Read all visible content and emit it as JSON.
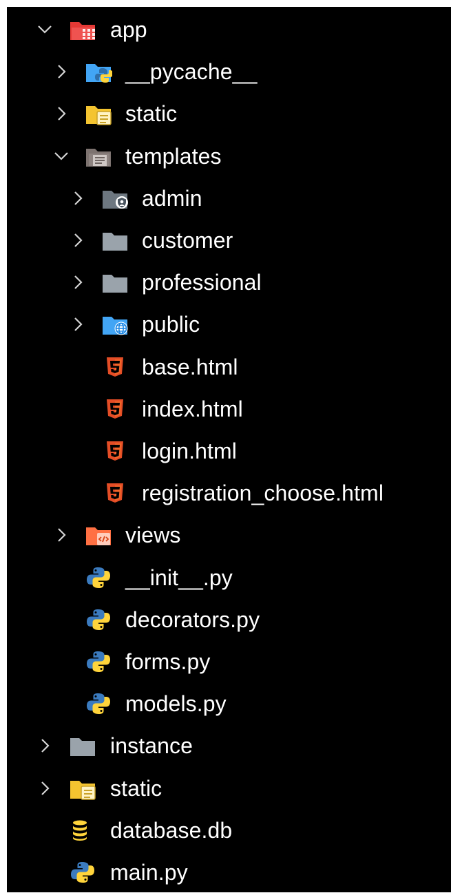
{
  "tree": [
    {
      "label": "app",
      "kind": "folder-open",
      "icon": "folder-app-icon",
      "depth": 0
    },
    {
      "label": "__pycache__",
      "kind": "folder",
      "icon": "folder-python-icon",
      "depth": 1
    },
    {
      "label": "static",
      "kind": "folder",
      "icon": "folder-static-icon",
      "depth": 1
    },
    {
      "label": "templates",
      "kind": "folder-open",
      "icon": "folder-templates-icon",
      "depth": 1
    },
    {
      "label": "admin",
      "kind": "folder",
      "icon": "folder-admin-icon",
      "depth": 2
    },
    {
      "label": "customer",
      "kind": "folder",
      "icon": "folder-icon",
      "depth": 2
    },
    {
      "label": "professional",
      "kind": "folder",
      "icon": "folder-icon",
      "depth": 2
    },
    {
      "label": "public",
      "kind": "folder",
      "icon": "folder-public-icon",
      "depth": 2
    },
    {
      "label": "base.html",
      "kind": "file",
      "icon": "html5-icon",
      "depth": 2
    },
    {
      "label": "index.html",
      "kind": "file",
      "icon": "html5-icon",
      "depth": 2
    },
    {
      "label": "login.html",
      "kind": "file",
      "icon": "html5-icon",
      "depth": 2
    },
    {
      "label": "registration_choose.html",
      "kind": "file",
      "icon": "html5-icon",
      "depth": 2
    },
    {
      "label": "views",
      "kind": "folder",
      "icon": "folder-views-icon",
      "depth": 1
    },
    {
      "label": "__init__.py",
      "kind": "file",
      "icon": "python-icon",
      "depth": 1
    },
    {
      "label": "decorators.py",
      "kind": "file",
      "icon": "python-icon",
      "depth": 1
    },
    {
      "label": "forms.py",
      "kind": "file",
      "icon": "python-icon",
      "depth": 1
    },
    {
      "label": "models.py",
      "kind": "file",
      "icon": "python-icon",
      "depth": 1
    },
    {
      "label": "instance",
      "kind": "folder",
      "icon": "folder-icon",
      "depth": 0
    },
    {
      "label": "static",
      "kind": "folder",
      "icon": "folder-static-icon",
      "depth": 0
    },
    {
      "label": "database.db",
      "kind": "file",
      "icon": "database-icon",
      "depth": 0
    },
    {
      "label": "main.py",
      "kind": "file",
      "icon": "python-icon",
      "depth": 0
    }
  ],
  "colors": {
    "background": "#000000",
    "text": "#ffffff",
    "chevron": "#d4d4d4",
    "folder_gray": "#9aa3ab",
    "folder_yellow": "#f4c430",
    "folder_blue": "#42a5f5",
    "folder_red": "#e53935",
    "folder_orange": "#ff7043",
    "html_orange": "#e44d26",
    "python_blue": "#3b7bbf",
    "python_yellow": "#ffd43b"
  }
}
